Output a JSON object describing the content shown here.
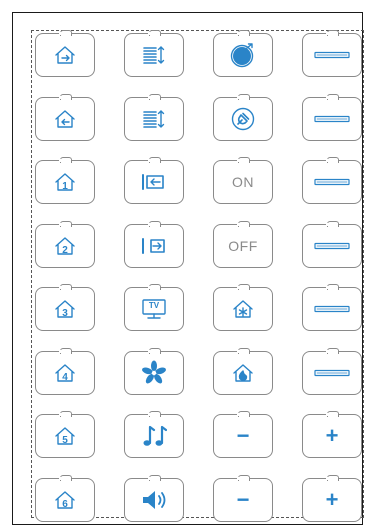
{
  "colors": {
    "accent": "#2a84c8",
    "outline": "#8a8a8a",
    "frame": "#1a1a1a",
    "background": "#ffffff"
  },
  "rows": [
    [
      {
        "name": "home-arrow-out-button",
        "icon": "home-arrow-right-icon"
      },
      {
        "name": "list-scroll-button-1",
        "icon": "list-updown-icon"
      },
      {
        "name": "power-knob-button",
        "icon": "power-knob-icon"
      },
      {
        "name": "fader-button-1",
        "icon": "fader-bar-icon"
      }
    ],
    [
      {
        "name": "home-arrow-in-button",
        "icon": "home-arrow-left-icon"
      },
      {
        "name": "list-scroll-button-2",
        "icon": "list-updown-icon"
      },
      {
        "name": "plug-button",
        "icon": "plug-icon"
      },
      {
        "name": "fader-button-2",
        "icon": "fader-bar-icon"
      }
    ],
    [
      {
        "name": "home-1-button",
        "icon": "home-number-icon",
        "label": "1"
      },
      {
        "name": "input-in-button",
        "icon": "arrow-into-bar-icon"
      },
      {
        "name": "on-button",
        "label": "ON"
      },
      {
        "name": "fader-button-3",
        "icon": "fader-bar-icon"
      }
    ],
    [
      {
        "name": "home-2-button",
        "icon": "home-number-icon",
        "label": "2"
      },
      {
        "name": "input-out-button",
        "icon": "arrow-out-box-icon"
      },
      {
        "name": "off-button",
        "label": "OFF"
      },
      {
        "name": "fader-button-4",
        "icon": "fader-bar-icon"
      }
    ],
    [
      {
        "name": "home-3-button",
        "icon": "home-number-icon",
        "label": "3"
      },
      {
        "name": "tv-button",
        "icon": "tv-icon",
        "label": "TV"
      },
      {
        "name": "home-cooling-button",
        "icon": "home-snowflake-icon"
      },
      {
        "name": "fader-button-5",
        "icon": "fader-bar-icon"
      }
    ],
    [
      {
        "name": "home-4-button",
        "icon": "home-number-icon",
        "label": "4"
      },
      {
        "name": "fan-button",
        "icon": "fan-icon"
      },
      {
        "name": "home-heating-button",
        "icon": "home-flame-icon"
      },
      {
        "name": "fader-button-6",
        "icon": "fader-bar-icon"
      }
    ],
    [
      {
        "name": "home-5-button",
        "icon": "home-number-icon",
        "label": "5"
      },
      {
        "name": "music-button",
        "icon": "music-note-icon"
      },
      {
        "name": "minus-button-1",
        "icon": "minus-icon",
        "label": "−"
      },
      {
        "name": "plus-button-1",
        "icon": "plus-icon",
        "label": "+"
      }
    ],
    [
      {
        "name": "home-6-button",
        "icon": "home-number-icon",
        "label": "6"
      },
      {
        "name": "volume-button",
        "icon": "speaker-icon"
      },
      {
        "name": "minus-button-2",
        "icon": "minus-icon",
        "label": "−"
      },
      {
        "name": "plus-button-2",
        "icon": "plus-icon",
        "label": "+"
      }
    ]
  ]
}
